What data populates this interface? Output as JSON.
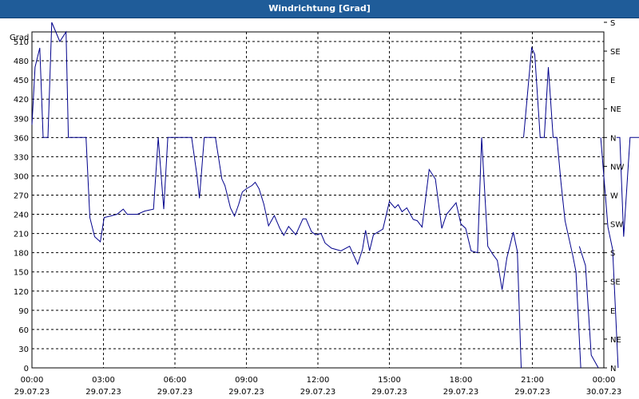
{
  "chart_data": {
    "type": "line",
    "title": "Windrichtung [Grad]",
    "ylabel": "Grad",
    "ylim": [
      0,
      525
    ],
    "yticks": [
      0,
      30,
      60,
      90,
      120,
      150,
      180,
      210,
      240,
      270,
      300,
      330,
      360,
      390,
      420,
      450,
      480,
      510
    ],
    "right_axis_labels": [
      {
        "value": 0,
        "label": "N"
      },
      {
        "value": 45,
        "label": "NE"
      },
      {
        "value": 90,
        "label": "E"
      },
      {
        "value": 135,
        "label": "SE"
      },
      {
        "value": 180,
        "label": "S"
      },
      {
        "value": 225,
        "label": "SW"
      },
      {
        "value": 270,
        "label": "W"
      },
      {
        "value": 315,
        "label": "NW"
      },
      {
        "value": 360,
        "label": "N"
      },
      {
        "value": 405,
        "label": "NE"
      },
      {
        "value": 450,
        "label": "E"
      },
      {
        "value": 495,
        "label": "SE"
      },
      {
        "value": 540,
        "label": "S"
      }
    ],
    "xlim": [
      0,
      24
    ],
    "xticks": [
      {
        "hour": 0,
        "time": "00:00",
        "date": "29.07.23"
      },
      {
        "hour": 3,
        "time": "03:00",
        "date": "29.07.23"
      },
      {
        "hour": 6,
        "time": "06:00",
        "date": "29.07.23"
      },
      {
        "hour": 9,
        "time": "09:00",
        "date": "29.07.23"
      },
      {
        "hour": 12,
        "time": "12:00",
        "date": "29.07.23"
      },
      {
        "hour": 15,
        "time": "15:00",
        "date": "29.07.23"
      },
      {
        "hour": 18,
        "time": "18:00",
        "date": "29.07.23"
      },
      {
        "hour": 21,
        "time": "21:00",
        "date": "29.07.23"
      },
      {
        "hour": 24,
        "time": "00:00",
        "date": "30.07.23"
      }
    ],
    "grid": true,
    "series": [
      {
        "color": "#00008b",
        "segments": [
          [
            [
              0.0,
              380
            ],
            [
              0.13,
              470
            ],
            [
              0.33,
              500
            ],
            [
              0.47,
              360
            ],
            [
              0.67,
              360
            ],
            [
              0.83,
              540
            ],
            [
              1.17,
              510
            ],
            [
              1.43,
              525
            ],
            [
              1.53,
              360
            ],
            [
              1.87,
              360
            ],
            [
              2.27,
              360
            ],
            [
              2.43,
              235
            ],
            [
              2.63,
              205
            ],
            [
              2.87,
              197
            ],
            [
              3.03,
              235
            ],
            [
              3.37,
              238
            ],
            [
              3.57,
              240
            ],
            [
              3.83,
              248
            ],
            [
              4.0,
              240
            ],
            [
              4.43,
              240
            ],
            [
              4.73,
              245
            ],
            [
              5.1,
              248
            ],
            [
              5.3,
              360
            ],
            [
              5.53,
              248
            ],
            [
              5.7,
              360
            ],
            [
              6.13,
              360
            ],
            [
              6.7,
              360
            ],
            [
              6.93,
              300
            ],
            [
              7.03,
              265
            ],
            [
              7.23,
              360
            ],
            [
              7.5,
              360
            ],
            [
              7.7,
              360
            ],
            [
              7.97,
              295
            ],
            [
              8.1,
              285
            ],
            [
              8.33,
              250
            ],
            [
              8.5,
              237
            ],
            [
              8.67,
              255
            ],
            [
              8.83,
              275
            ],
            [
              9.0,
              280
            ],
            [
              9.23,
              285
            ],
            [
              9.37,
              290
            ],
            [
              9.53,
              280
            ],
            [
              9.73,
              256
            ],
            [
              9.93,
              222
            ],
            [
              10.17,
              238
            ],
            [
              10.4,
              218
            ],
            [
              10.57,
              207
            ],
            [
              10.77,
              221
            ],
            [
              11.07,
              208
            ],
            [
              11.37,
              233
            ],
            [
              11.5,
              233
            ],
            [
              11.73,
              213
            ],
            [
              11.9,
              208
            ],
            [
              12.13,
              210
            ],
            [
              12.3,
              195
            ],
            [
              12.57,
              187
            ],
            [
              12.97,
              183
            ],
            [
              13.33,
              190
            ],
            [
              13.67,
              162
            ],
            [
              13.87,
              185
            ],
            [
              14.0,
              215
            ],
            [
              14.17,
              183
            ],
            [
              14.33,
              208
            ],
            [
              14.73,
              217
            ],
            [
              15.0,
              260
            ],
            [
              15.23,
              250
            ],
            [
              15.37,
              255
            ],
            [
              15.53,
              244
            ],
            [
              15.73,
              250
            ],
            [
              16.0,
              232
            ],
            [
              16.17,
              230
            ],
            [
              16.37,
              220
            ],
            [
              16.67,
              310
            ],
            [
              16.93,
              295
            ],
            [
              17.2,
              218
            ],
            [
              17.4,
              240
            ],
            [
              17.8,
              258
            ],
            [
              18.0,
              225
            ],
            [
              18.2,
              218
            ],
            [
              18.43,
              183
            ],
            [
              18.7,
              180
            ],
            [
              18.87,
              360
            ],
            [
              19.13,
              190
            ],
            [
              19.33,
              178
            ],
            [
              19.53,
              168
            ],
            [
              19.73,
              122
            ],
            [
              19.93,
              172
            ],
            [
              20.2,
              212
            ],
            [
              20.37,
              182
            ],
            [
              20.53,
              0
            ]
          ],
          [
            [
              20.63,
              360
            ],
            [
              20.97,
              500
            ],
            [
              21.1,
              490
            ],
            [
              21.33,
              360
            ],
            [
              21.5,
              360
            ],
            [
              21.67,
              470
            ],
            [
              21.87,
              360
            ],
            [
              22.03,
              360
            ],
            [
              22.2,
              290
            ],
            [
              22.37,
              230
            ],
            [
              22.7,
              175
            ],
            [
              22.83,
              150
            ],
            [
              23.03,
              0
            ]
          ],
          [
            [
              22.97,
              190
            ],
            [
              23.23,
              160
            ],
            [
              23.47,
              20
            ],
            [
              23.77,
              0
            ]
          ],
          [
            [
              23.87,
              360
            ],
            [
              24.17,
              220
            ],
            [
              24.37,
              185
            ],
            [
              24.6,
              0
            ]
          ],
          [
            [
              24.53,
              360
            ],
            [
              24.67,
              360
            ],
            [
              24.83,
              205
            ],
            [
              25.1,
              360
            ],
            [
              25.37,
              360
            ],
            [
              25.53,
              360
            ],
            [
              25.67,
              360
            ],
            [
              25.8,
              360
            ],
            [
              26.03,
              445
            ]
          ]
        ]
      }
    ]
  }
}
